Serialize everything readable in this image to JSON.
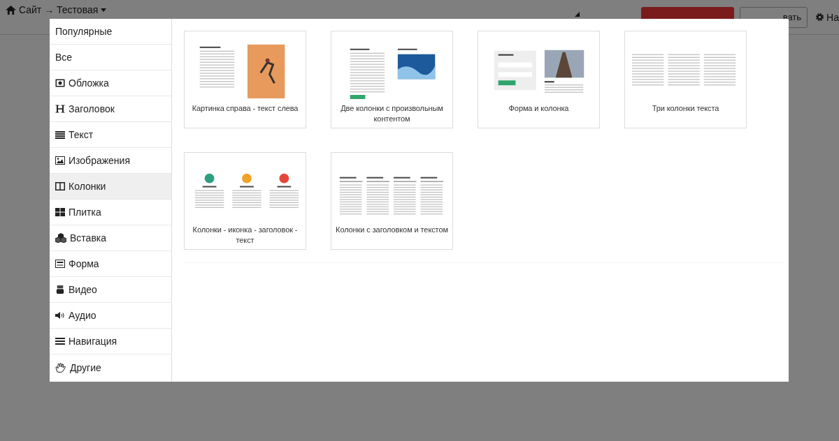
{
  "header": {
    "breadcrumb": "Сайт → Тестовая",
    "outline_button": "вать",
    "settings_link": "На"
  },
  "sidebar": {
    "items": [
      {
        "label": "Популярные",
        "kind": "plain",
        "selected": false
      },
      {
        "label": "Все",
        "kind": "plain",
        "selected": false
      },
      {
        "label": "Обложка",
        "kind": "cover",
        "selected": false
      },
      {
        "label": "Заголовок",
        "kind": "heading",
        "selected": false
      },
      {
        "label": "Текст",
        "kind": "text",
        "selected": false
      },
      {
        "label": "Изображения",
        "kind": "image",
        "selected": false
      },
      {
        "label": "Колонки",
        "kind": "columns",
        "selected": true
      },
      {
        "label": "Плитка",
        "kind": "tiles",
        "selected": false
      },
      {
        "label": "Вставка",
        "kind": "embed",
        "selected": false
      },
      {
        "label": "Форма",
        "kind": "form",
        "selected": false
      },
      {
        "label": "Видео",
        "kind": "video",
        "selected": false
      },
      {
        "label": "Аудио",
        "kind": "audio",
        "selected": false
      },
      {
        "label": "Навигация",
        "kind": "nav",
        "selected": false
      },
      {
        "label": "Другие",
        "kind": "other",
        "selected": false
      }
    ]
  },
  "templates": [
    {
      "title": "Картинка справа - текст слева",
      "kind": "image-right"
    },
    {
      "title": "Две колонки с произвольным контентом",
      "kind": "two-columns"
    },
    {
      "title": "Форма и колонка",
      "kind": "form-column"
    },
    {
      "title": "Три колонки текста",
      "kind": "three-columns"
    },
    {
      "title": "Колонки - иконка - заголовок - текст",
      "kind": "icon-columns"
    },
    {
      "title": "Колонки с заголовком и текстом",
      "kind": "heading-columns"
    }
  ]
}
